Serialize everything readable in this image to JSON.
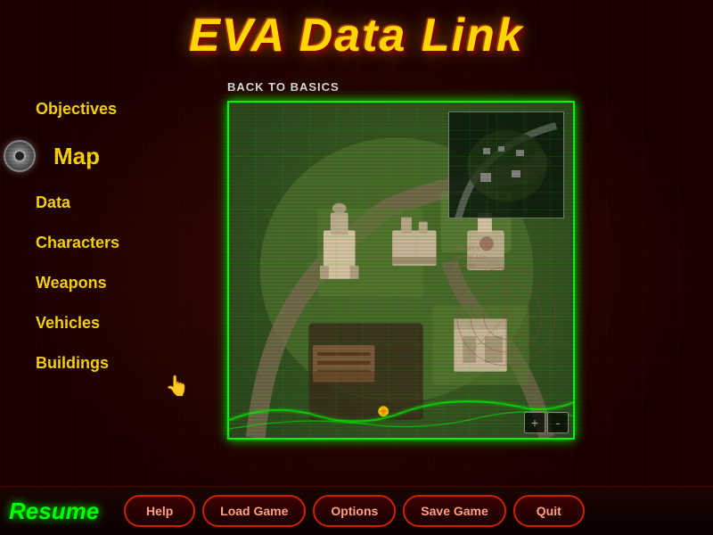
{
  "title": "EVA Data Link",
  "mission": {
    "label": "BACK TO BASICS"
  },
  "sidebar": {
    "items": [
      {
        "id": "objectives",
        "label": "Objectives",
        "active": false
      },
      {
        "id": "map",
        "label": "Map",
        "active": true
      },
      {
        "id": "data",
        "label": "Data",
        "active": false
      },
      {
        "id": "characters",
        "label": "Characters",
        "active": false
      },
      {
        "id": "weapons",
        "label": "Weapons",
        "active": false
      },
      {
        "id": "vehicles",
        "label": "Vehicles",
        "active": false
      },
      {
        "id": "buildings",
        "label": "Buildings",
        "active": false
      }
    ]
  },
  "buttons": {
    "resume": "Resume",
    "help": "Help",
    "loadGame": "Load Game",
    "options": "Options",
    "saveGame": "Save Game",
    "quit": "Quit"
  },
  "mapControls": {
    "zoomIn": "+",
    "zoomOut": "-"
  },
  "colors": {
    "titleYellow": "#FFD700",
    "activeGreen": "#00FF00",
    "resumeGreen": "#00FF00",
    "borderRed": "#cc2200",
    "navGold": "#FFD700"
  }
}
